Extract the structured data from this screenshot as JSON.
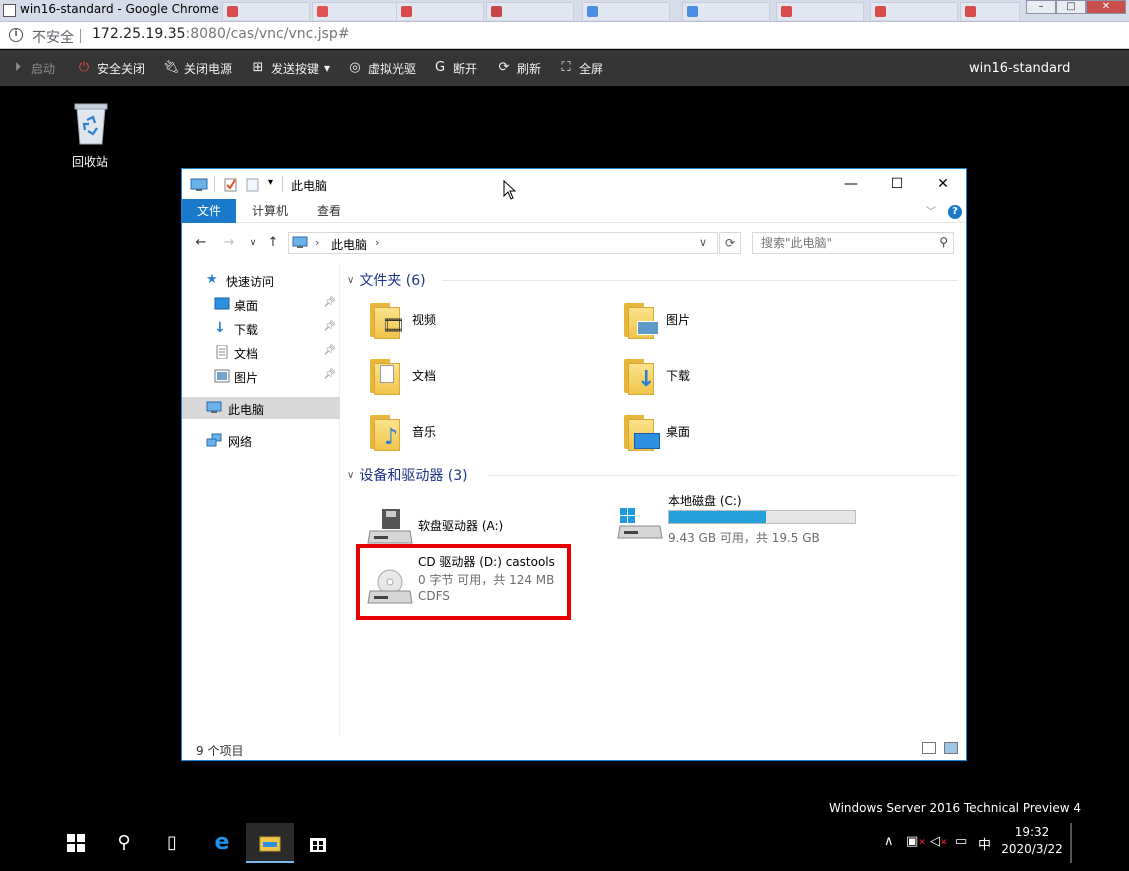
{
  "browser": {
    "window_title": "win16-standard - Google Chrome",
    "insecure_label": "不安全",
    "url_host": "172.25.19.35",
    "url_rest": ":8080/cas/vnc/vnc.jsp#",
    "tab_colors": [
      "#d94a4a",
      "#e15252",
      "#d94a4a",
      "#c8474a",
      "#d94a4a",
      "#4a8fe2",
      "#4a8fe2",
      "#d94a4a",
      "#d94a4a",
      "#d94a4a"
    ]
  },
  "vnc_toolbar": {
    "start": "启动",
    "safe_shutdown": "安全关闭",
    "power_off": "关闭电源",
    "send_keys": "发送按键",
    "virtual_cdrom": "虚拟光驱",
    "disconnect": "断开",
    "refresh": "刷新",
    "fullscreen": "全屏",
    "host_name": "win16-standard"
  },
  "desktop": {
    "recycle_bin_label": "回收站",
    "watermark": "Windows Server 2016 Technical Preview 4"
  },
  "explorer": {
    "title": "此电脑",
    "ribbon_tabs": [
      "文件",
      "计算机",
      "查看"
    ],
    "breadcrumb": "此电脑",
    "search_placeholder": "搜索\"此电脑\"",
    "sidebar": {
      "quick_access": "快速访问",
      "desktop": "桌面",
      "downloads": "下载",
      "documents": "文档",
      "pictures": "图片",
      "this_pc": "此电脑",
      "network": "网络"
    },
    "folders_header": "文件夹 (6)",
    "folders": [
      "视频",
      "图片",
      "文档",
      "下载",
      "音乐",
      "桌面"
    ],
    "drives_header": "设备和驱动器 (3)",
    "drives": {
      "floppy": {
        "name": "软盘驱动器 (A:)"
      },
      "local": {
        "name": "本地磁盘 (C:)",
        "space": "9.43 GB 可用，共 19.5 GB",
        "used_fraction": 0.52
      },
      "cd": {
        "name": "CD 驱动器 (D:) castools",
        "space": "0 字节 可用，共 124 MB",
        "fs": "CDFS"
      }
    },
    "status_count": "9 个项目"
  },
  "taskbar": {
    "ime": "中",
    "time": "19:32",
    "date": "2020/3/22"
  }
}
